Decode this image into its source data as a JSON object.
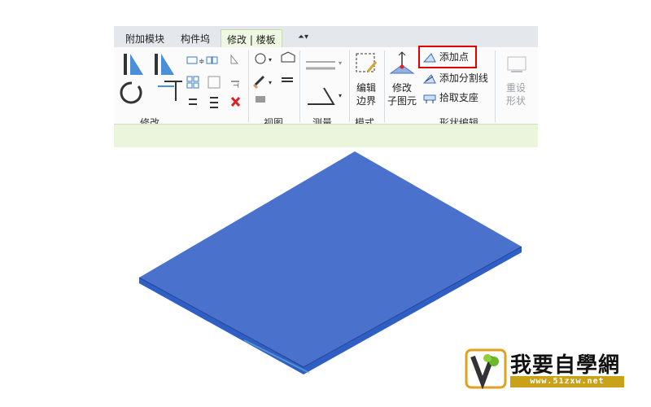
{
  "tabs": [
    {
      "label": "附加模块"
    },
    {
      "label": "构件坞"
    },
    {
      "label": "修改 | 楼板"
    }
  ],
  "groups": {
    "modify": "修改",
    "view": "视图",
    "measure": "测量",
    "mode": "模式",
    "shape_edit": "形状编辑"
  },
  "tools": {
    "edit_boundary": [
      "编辑",
      "边界"
    ],
    "modify_subelements": [
      "修改",
      "子图元"
    ],
    "add_point": "添加点",
    "add_split_line": "添加分割线",
    "pick_supports": "拾取支座",
    "reset_shape": [
      "重设",
      "形状"
    ]
  },
  "colors": {
    "slab_top": "#4a72cc",
    "slab_edge": "#2f5fc4",
    "highlight": "#e00000"
  },
  "watermark": {
    "text": "我要自學網",
    "url": "www.51zxw.net"
  }
}
